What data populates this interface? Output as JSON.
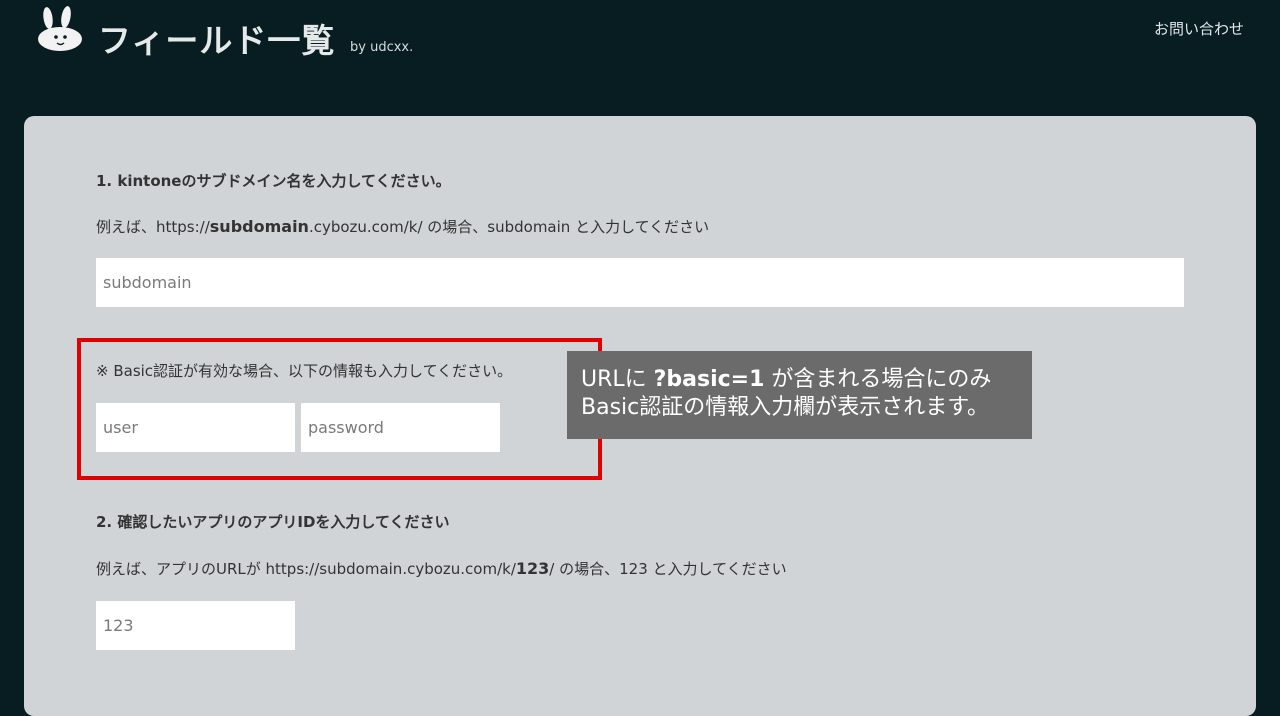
{
  "header": {
    "title": "フィールド一覧",
    "byline": "by udcxx.",
    "contact_label": "お問い合わせ",
    "logo_icon": "rabbit-icon"
  },
  "step1": {
    "heading": "1. kintoneのサブドメイン名を入力してください。",
    "example_prefix": "例えば、https://",
    "example_bold": "subdomain",
    "example_suffix": ".cybozu.com/k/ の場合、subdomain と入力してください",
    "input_placeholder": "subdomain"
  },
  "basic_auth": {
    "note": "※ Basic認証が有効な場合、以下の情報も入力してください。",
    "user_placeholder": "user",
    "password_placeholder": "password"
  },
  "callout": {
    "line1_prefix": "URLに ",
    "line1_bold": "?basic=1",
    "line1_suffix": " が含まれる場合にのみ",
    "line2": "Basic認証の情報入力欄が表示されます。"
  },
  "step2": {
    "heading": "2. 確認したいアプリのアプリIDを入力してください",
    "example_prefix": "例えば、アプリのURLが https://subdomain.cybozu.com/k/",
    "example_bold": "123",
    "example_suffix": "/ の場合、123 と入力してください",
    "input_placeholder": "123"
  },
  "colors": {
    "background": "#071d22",
    "panel": "#d0d4d6",
    "highlight": "#e00000",
    "callout": "#6b6b6b"
  }
}
